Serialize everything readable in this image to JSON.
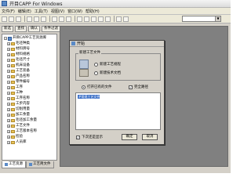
{
  "window": {
    "title": "开目CAPP For Windows"
  },
  "menu": [
    "文件(F)",
    "编辑(E)",
    "工具(T)",
    "视图(V)",
    "窗口(W)",
    "帮助(H)"
  ],
  "side_buttons": [
    "新选",
    "查找",
    "确认",
    "条件过滤"
  ],
  "tree": {
    "root": "开目CAPP工艺资源库",
    "items": [
      "毛坯种类",
      "材料牌号",
      "材料规格",
      "毛坯尺寸",
      "机床设备",
      "工艺装备",
      "产品名称",
      "零件编号",
      "工序",
      "工种",
      "工序名称",
      "工步内容",
      "切削用量",
      "加工余量",
      "毛坯加工余量",
      "工艺文件",
      "工艺版本名称",
      "检验",
      "人员库"
    ]
  },
  "tabs": [
    "工艺资源",
    "工艺简文件"
  ],
  "dialog": {
    "title": "开始",
    "group_label": "新建工艺文件",
    "radio_new_procedure": "新建工艺规程",
    "radio_new_tech_doc": "新建技术文档",
    "radio_open_existing": "打开已有的文件",
    "check_full_path": "完全路径",
    "list_selected_item": "#常规工艺文件",
    "check_show_next": "下次还是显示",
    "ok_label": "确定",
    "cancel_label": "取消"
  },
  "colors": {
    "selection": "#3a6fc7",
    "mdi_background": "#808080",
    "dialog_face": "#d4d0c8"
  }
}
